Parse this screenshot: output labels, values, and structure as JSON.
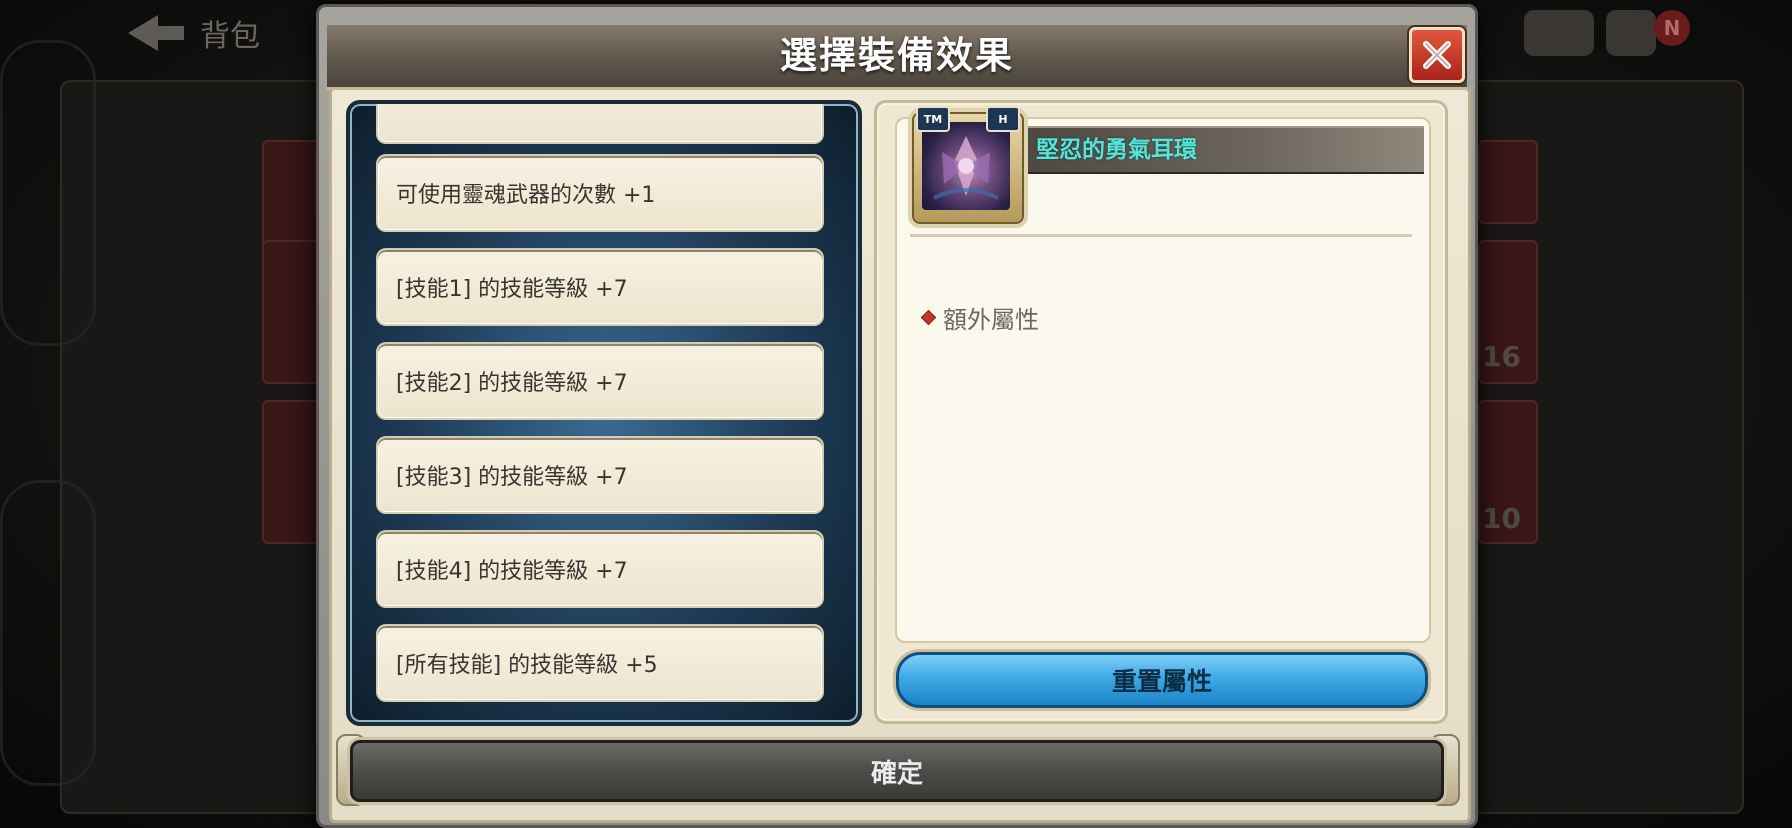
{
  "background": {
    "back_label": "背包",
    "badge_text": "N",
    "side_numbers": [
      "16",
      "10"
    ]
  },
  "dialog": {
    "title": "選擇裝備效果",
    "close_label": "X"
  },
  "effect_list": {
    "items": [
      {
        "label": "可使用靈魂武器的次數  +1"
      },
      {
        "label": "[技能1] 的技能等級  +7"
      },
      {
        "label": "[技能2] 的技能等級  +7"
      },
      {
        "label": "[技能3] 的技能等級  +7"
      },
      {
        "label": "[技能4] 的技能等級  +7"
      },
      {
        "label": "[所有技能] 的技能等級  +5"
      }
    ]
  },
  "detail": {
    "item_name": "堅忍的勇氣耳環",
    "icon_badges": [
      "TM",
      "H"
    ],
    "extra_attribute_label": "額外屬性",
    "reset_label": "重置屬性"
  },
  "footer": {
    "confirm_label": "確定"
  },
  "colors": {
    "title_text": "#ffffff",
    "item_name_text": "#59e3d8",
    "reset_button": "#3ea9e6",
    "close_button": "#c33a25"
  },
  "icons": [
    "back-arrow-icon",
    "close-icon",
    "earring-item-icon",
    "diamond-bullet-icon"
  ]
}
